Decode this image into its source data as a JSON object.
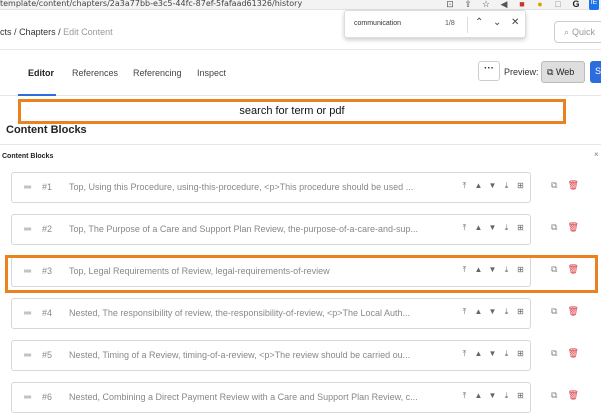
{
  "browser": {
    "url": "template/content/chapters/2a3a77bb-e3c5-44fc-87ef-5fafaad61326/history",
    "icons": [
      "lock-icon",
      "share-icon",
      "star-icon",
      "megaphone-icon",
      "extension-red-icon",
      "extension-yellow-icon",
      "extension-gray-icon",
      "g-icon",
      "profile-badge-icon"
    ]
  },
  "find": {
    "query": "communication",
    "count": "1/8"
  },
  "breadcrumb": {
    "part1": "cts",
    "sep": "/",
    "part2": "Chapters",
    "part3": "Edit Content"
  },
  "quick_search": {
    "placeholder": "Quick"
  },
  "tabs": [
    "Editor",
    "References",
    "Referencing",
    "Inspect"
  ],
  "toolbar": {
    "more_label": "···",
    "preview_label": "Preview:",
    "web_label": "Web",
    "blue_label": "S"
  },
  "annotation": {
    "text": "search for term or  pdf"
  },
  "content_blocks": {
    "title": "Content Blocks",
    "panel_title": "Content Blocks",
    "close_label": "×",
    "rows": [
      {
        "num": "#1",
        "text": "Top, Using this Procedure, using-this-procedure, <p>This procedure should be used ..."
      },
      {
        "num": "#2",
        "text": "Top, The Purpose of a Care and Support Plan Review, the-purpose-of-a-care-and-sup..."
      },
      {
        "num": "#3",
        "text": "Top, Legal Requirements of Review, legal-requirements-of-review"
      },
      {
        "num": "#4",
        "text": "Nested, The responsibility of review, the-responsibility-of-review, <p>The Local Auth..."
      },
      {
        "num": "#5",
        "text": "Nested, Timing of a Review, timing-of-a-review, <p>The review should be carried ou..."
      },
      {
        "num": "#6",
        "text": "Nested, Combining a Direct Payment Review with a Care and Support Plan Review, c..."
      }
    ]
  },
  "colors": {
    "accent": "#2d6cdf",
    "highlight": "#ec8120",
    "delete": "#d9363e"
  }
}
